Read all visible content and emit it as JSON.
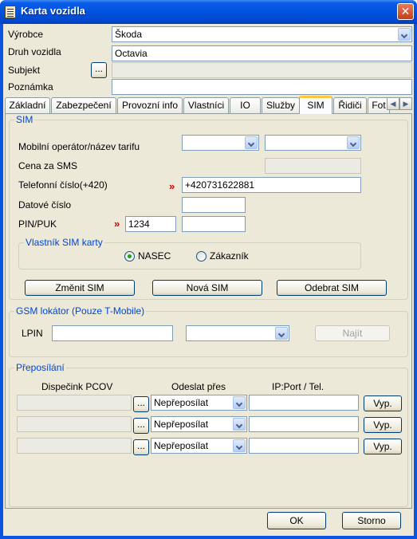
{
  "window": {
    "title": "Karta vozidla",
    "close_glyph": "✕"
  },
  "header": {
    "vyrobce_label": "Výrobce",
    "vyrobce_value": "Škoda",
    "druh_label": "Druh vozidla",
    "druh_value": "Octavia",
    "subjekt_label": "Subjekt",
    "subjekt_button": "...",
    "subjekt_value": "",
    "poznamka_label": "Poznámka",
    "poznamka_value": ""
  },
  "tabs": [
    {
      "label": "Základní"
    },
    {
      "label": "Zabezpečení"
    },
    {
      "label": "Provozní info"
    },
    {
      "label": "Vlastníci"
    },
    {
      "label": "IO"
    },
    {
      "label": "Služby"
    },
    {
      "label": "SIM",
      "active": true
    },
    {
      "label": "Řidiči"
    },
    {
      "label": "Fot"
    }
  ],
  "tab_scroll": {
    "left_glyph": "◀",
    "right_glyph": "▶"
  },
  "sim": {
    "group_title": "SIM",
    "operator_label": "Mobilní operátor/název tarifu",
    "operator_value": "",
    "tariff_value": "",
    "cena_label": "Cena za SMS",
    "cena_value": "",
    "telefon_label": "Telefonní číslo(+420)",
    "telefon_value": "+420731622881",
    "datove_label": "Datové číslo",
    "datove_value": "",
    "pinpuk_label": "PIN/PUK",
    "pin_value": "1234",
    "puk_value": "",
    "required_marker": "»",
    "owner_group_title": "Vlastník SIM karty",
    "owner_options": [
      {
        "label": "NASEC",
        "checked": true
      },
      {
        "label": "Zákazník",
        "checked": false
      }
    ],
    "buttons": {
      "change": "Změnit SIM",
      "new": "Nová SIM",
      "remove": "Odebrat SIM"
    }
  },
  "gsm": {
    "group_title": "GSM lokátor (Pouze T-Mobile)",
    "lpin_label": "LPIN",
    "lpin_value": "",
    "select_value": "",
    "find_button": "Najít"
  },
  "forwarding": {
    "group_title": "Přeposílání",
    "headers": {
      "dispatcher": "Dispečink PCOV",
      "send_via": "Odeslat přes",
      "ip": "IP:Port / Tel."
    },
    "rows": [
      {
        "dispatcher": "",
        "button": "...",
        "send_via": "Nepřeposílat",
        "ip": "",
        "off_button": "Vyp."
      },
      {
        "dispatcher": "",
        "button": "...",
        "send_via": "Nepřeposílat",
        "ip": "",
        "off_button": "Vyp."
      },
      {
        "dispatcher": "",
        "button": "...",
        "send_via": "Nepřeposílat",
        "ip": "",
        "off_button": "Vyp."
      }
    ]
  },
  "footer": {
    "ok": "OK",
    "cancel": "Storno"
  },
  "colors": {
    "title_bar": "#0052e0",
    "client": "#ece9d8",
    "group_title": "#0046d5",
    "required": "#d00000",
    "active_tab_accent": "#ffc83c"
  }
}
